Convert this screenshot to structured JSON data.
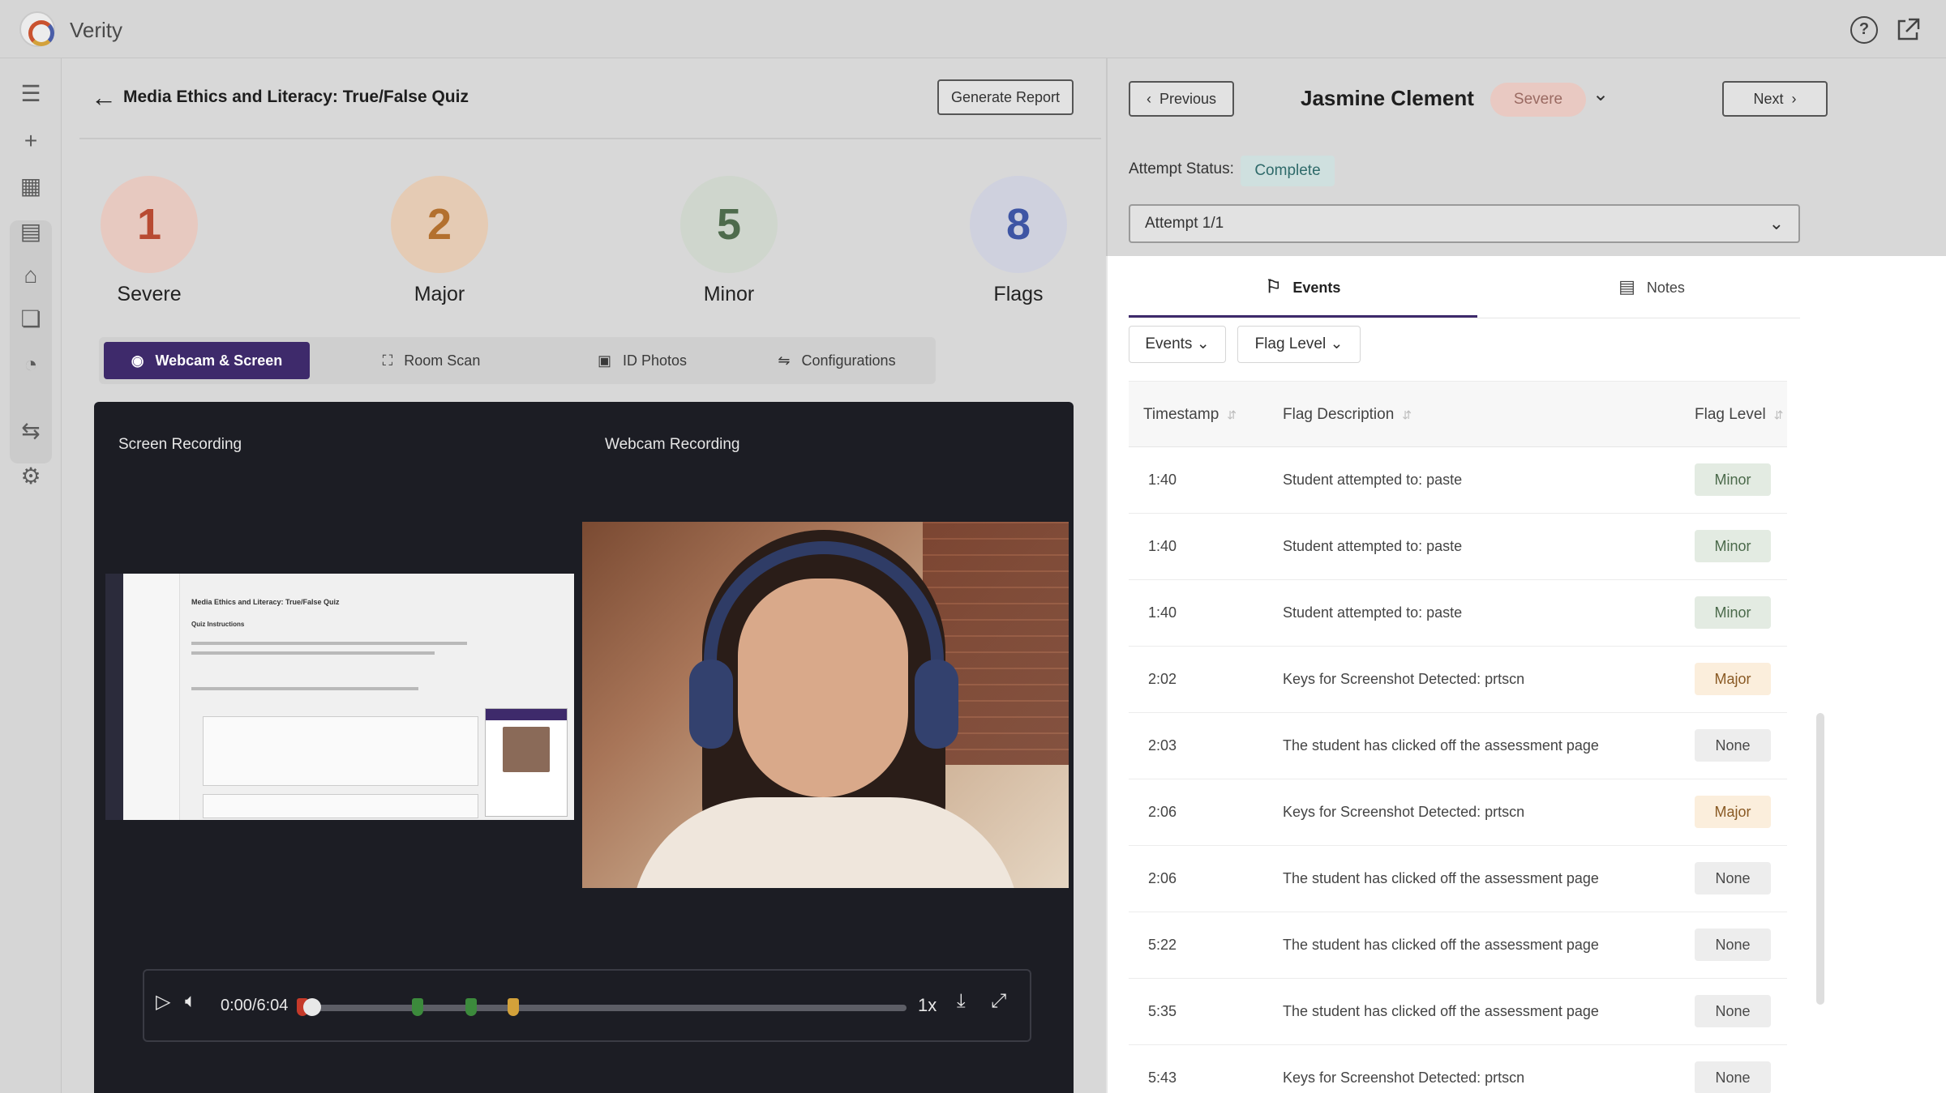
{
  "app": {
    "title": "Verity"
  },
  "header": {
    "quiz_title": "Media Ethics and Literacy: True/False Quiz",
    "generate_report": "Generate Report"
  },
  "stats": [
    {
      "value": "1",
      "label": "Severe",
      "bg": "#e7c9c0",
      "fg": "#b84a32"
    },
    {
      "value": "2",
      "label": "Major",
      "bg": "#e5cbb4",
      "fg": "#b3702e"
    },
    {
      "value": "5",
      "label": "Minor",
      "bg": "#cfd6cd",
      "fg": "#4e6b4c"
    },
    {
      "value": "8",
      "label": "Flags",
      "bg": "#cfd1de",
      "fg": "#3e55a4"
    }
  ],
  "media_tabs": [
    "Webcam & Screen",
    "Room Scan",
    "ID Photos",
    "Configurations"
  ],
  "player": {
    "screen_label": "Screen Recording",
    "webcam_label": "Webcam Recording",
    "time": "0:00/6:04",
    "speed": "1x",
    "thumb": {
      "title": "Media Ethics and Literacy: True/False Quiz",
      "subtitle": "Quiz Instructions"
    }
  },
  "student": {
    "previous": "Previous",
    "next": "Next",
    "name": "Jasmine Clement",
    "severity": "Severe",
    "status_label": "Attempt Status:",
    "status_value": "Complete",
    "attempt": "Attempt 1/1"
  },
  "right_tabs": {
    "events": "Events",
    "notes": "Notes"
  },
  "filters": {
    "events": "Events",
    "flag_level": "Flag Level"
  },
  "table": {
    "headers": [
      "Timestamp",
      "Flag Description",
      "Flag Level"
    ],
    "rows": [
      {
        "time": "1:40",
        "desc": "Student attempted to: paste",
        "level": "Minor"
      },
      {
        "time": "1:40",
        "desc": "Student attempted to: paste",
        "level": "Minor"
      },
      {
        "time": "1:40",
        "desc": "Student attempted to: paste",
        "level": "Minor"
      },
      {
        "time": "2:02",
        "desc": "Keys for Screenshot Detected: prtscn",
        "level": "Major"
      },
      {
        "time": "2:03",
        "desc": "The student has clicked off the assessment page",
        "level": "None"
      },
      {
        "time": "2:06",
        "desc": "Keys for Screenshot Detected: prtscn",
        "level": "Major"
      },
      {
        "time": "2:06",
        "desc": "The student has clicked off the assessment page",
        "level": "None"
      },
      {
        "time": "5:22",
        "desc": "The student has clicked off the assessment page",
        "level": "None"
      },
      {
        "time": "5:35",
        "desc": "The student has clicked off the assessment page",
        "level": "None"
      },
      {
        "time": "5:43",
        "desc": "Keys for Screenshot Detected: prtscn",
        "level": "None"
      }
    ]
  },
  "level_colors": {
    "Minor": {
      "bg": "#e3ebe2",
      "fg": "#4b6a4b"
    },
    "Major": {
      "bg": "#fbeedc",
      "fg": "#8a5a24"
    },
    "None": {
      "bg": "#ededed",
      "fg": "#4a4a4a"
    }
  }
}
